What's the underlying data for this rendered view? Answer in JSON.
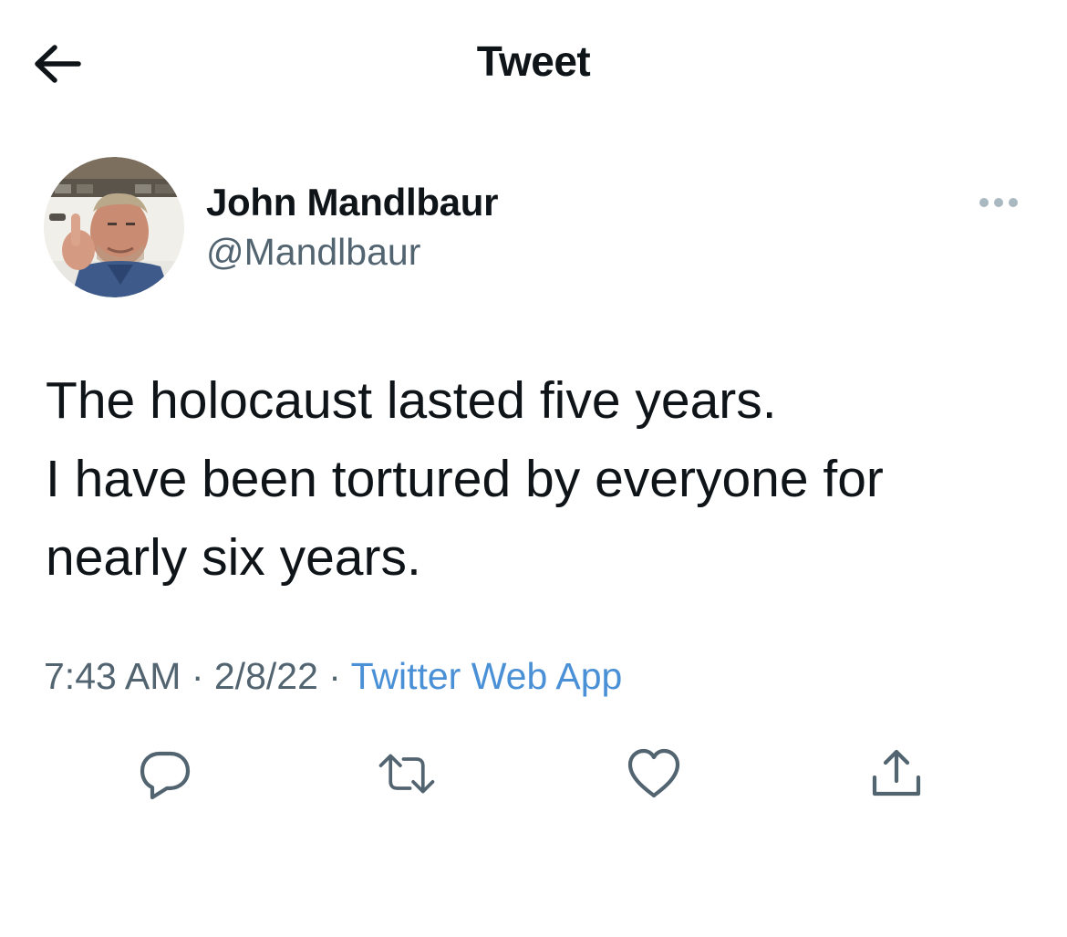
{
  "header": {
    "title": "Tweet",
    "back_icon": "arrow-left-icon"
  },
  "tweet": {
    "author": {
      "display_name": "John Mandlbaur",
      "handle": "@Mandlbaur",
      "avatar": "avatar-photo"
    },
    "text_lines": [
      "The holocaust lasted five years.",
      "I have been tortured by everyone for",
      "nearly six years."
    ],
    "meta": {
      "time": "7:43 AM",
      "separator": " · ",
      "date": "2/8/22",
      "source": "Twitter Web App"
    },
    "actions": [
      {
        "icon": "reply-icon"
      },
      {
        "icon": "retweet-icon"
      },
      {
        "icon": "like-icon"
      },
      {
        "icon": "share-icon"
      }
    ],
    "more_icon": "more-dots-icon"
  },
  "colors": {
    "text": "#0f1419",
    "secondary": "#536471",
    "link": "#4a90d6",
    "icon": "#536471"
  }
}
